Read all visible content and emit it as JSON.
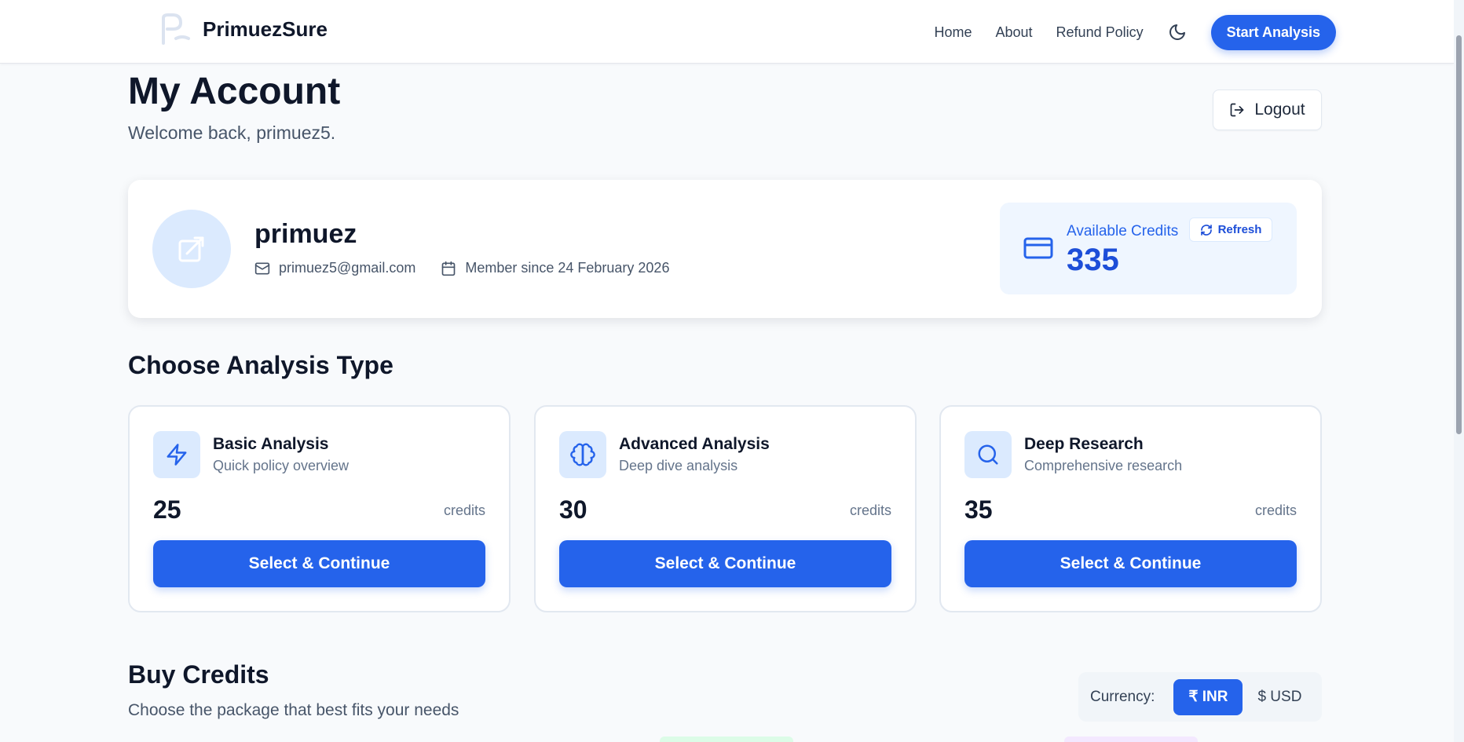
{
  "nav": {
    "brand": "PrimuezSure",
    "links": [
      "Home",
      "About",
      "Refund Policy"
    ],
    "start_button": "Start Analysis"
  },
  "header": {
    "title": "My Account",
    "welcome": "Welcome back, primuez5.",
    "logout": "Logout"
  },
  "profile": {
    "name": "primuez",
    "email": "primuez5@gmail.com",
    "member_since": "Member since 24 February 2026",
    "credits_label": "Available Credits",
    "credits_value": "335",
    "refresh": "Refresh"
  },
  "analysis": {
    "title": "Choose Analysis Type",
    "cards": [
      {
        "icon": "lightning-icon",
        "title": "Basic Analysis",
        "subtitle": "Quick policy overview",
        "cost": "25",
        "unit": "credits",
        "button": "Select & Continue"
      },
      {
        "icon": "brain-icon",
        "title": "Advanced Analysis",
        "subtitle": "Deep dive analysis",
        "cost": "30",
        "unit": "credits",
        "button": "Select & Continue"
      },
      {
        "icon": "search-icon",
        "title": "Deep Research",
        "subtitle": "Comprehensive research",
        "cost": "35",
        "unit": "credits",
        "button": "Select & Continue"
      }
    ]
  },
  "buy": {
    "title": "Buy Credits",
    "subtitle": "Choose the package that best fits your needs",
    "currency_label": "Currency:",
    "currency_options": [
      "₹ INR",
      "$ USD"
    ],
    "selected_currency": "₹ INR"
  },
  "colors": {
    "accent": "#2563eb",
    "accent_light": "#dbeafe",
    "background": "#f8fafc"
  }
}
